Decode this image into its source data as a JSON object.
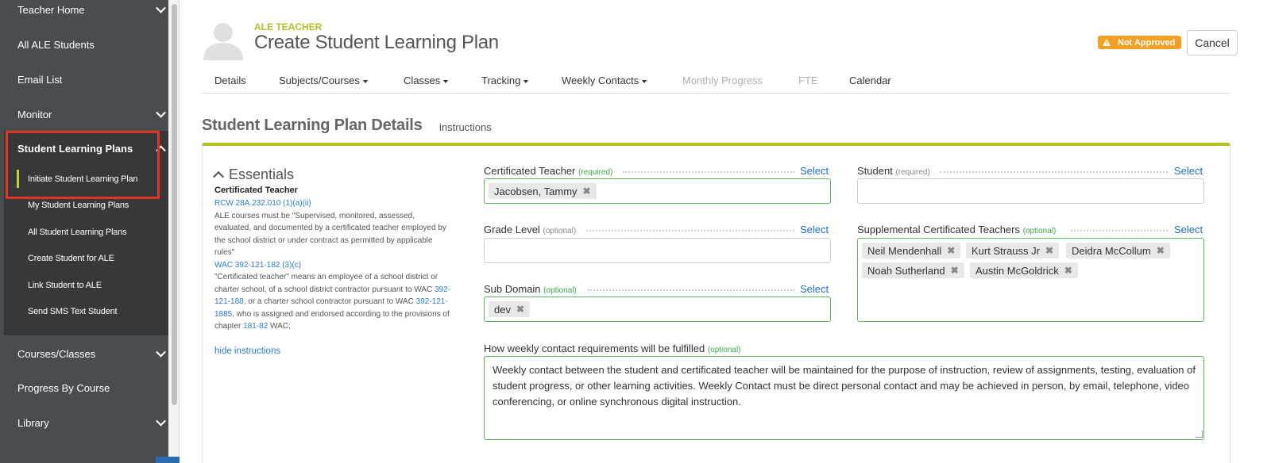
{
  "sidebar": {
    "items": [
      {
        "label": "Teacher Home"
      },
      {
        "label": "All ALE Students"
      },
      {
        "label": "Email List"
      },
      {
        "label": "Monitor"
      },
      {
        "label": "Student Learning Plans"
      },
      {
        "label": "Courses/Classes"
      },
      {
        "label": "Progress By Course"
      },
      {
        "label": "Library"
      }
    ],
    "subitems": [
      {
        "label": "Initiate Student Learning Plan"
      },
      {
        "label": "My Student Learning Plans"
      },
      {
        "label": "All Student Learning Plans"
      },
      {
        "label": "Create Student for ALE"
      },
      {
        "label": "Link Student to ALE"
      },
      {
        "label": "Send SMS Text Student"
      }
    ]
  },
  "header": {
    "role": "ALE TEACHER",
    "title": "Create Student Learning Plan",
    "status_badge": "Not Approved",
    "cancel_label": "Cancel"
  },
  "tabs": [
    {
      "label": "Details"
    },
    {
      "label": "Subjects/Courses"
    },
    {
      "label": "Classes"
    },
    {
      "label": "Tracking"
    },
    {
      "label": "Weekly Contacts"
    },
    {
      "label": "Monthly Progress"
    },
    {
      "label": "FTE"
    },
    {
      "label": "Calendar"
    }
  ],
  "section": {
    "title": "Student Learning Plan Details",
    "instructions_link": "instructions"
  },
  "essentials": {
    "heading": "Essentials",
    "subheading": "Certificated Teacher",
    "ref1": "RCW 28A.232.010 (1)(a)(ii)",
    "text1": "ALE courses must be \"Supervised, monitored, assessed, evaluated, and documented by a certificated teacher employed by the school district or under contract as permitted by applicable rules\"",
    "ref2": "WAC 392-121-182 (3)(c)",
    "text2a": "\"Certificated teacher\" means an employee of a school district or charter school, of a school district contractor pursuant to WAC ",
    "ref3": "392-121-188",
    "text2b": ", or a charter school contractor pursuant to WAC ",
    "ref4": "392-121-1885",
    "text2c": ", who is assigned and endorsed according to the provisions of chapter ",
    "ref5": "181-82",
    "text2d": " WAC;",
    "hide_label": "hide instructions"
  },
  "form": {
    "select_label": "Select",
    "certificated_teacher": {
      "label": "Certificated Teacher",
      "hint": "(required)",
      "value": "Jacobsen, Tammy"
    },
    "student": {
      "label": "Student",
      "hint": "(required)"
    },
    "grade_level": {
      "label": "Grade Level",
      "hint": "(optional)"
    },
    "supplemental": {
      "label": "Supplemental Certificated Teachers",
      "hint": "(optional)",
      "values": [
        "Neil Mendenhall",
        "Kurt Strauss Jr",
        "Deidra McCollum",
        "Noah Sutherland",
        "Austin McGoldrick"
      ]
    },
    "sub_domain": {
      "label": "Sub Domain",
      "hint": "(optional)",
      "value": "dev"
    },
    "weekly_contact": {
      "label": "How weekly contact requirements will be fulfilled",
      "hint": "(optional)",
      "value": "Weekly contact between the student and certificated teacher will be maintained for the purpose of instruction, review of assignments, testing, evaluation of student progress, or other learning activities. Weekly Contact must be direct personal contact and may be achieved in person, by email, telephone, video conferencing, or online synchronous digital instruction."
    }
  },
  "colors": {
    "accent": "#b5c025",
    "badge": "#f4a023",
    "link": "#2a7ad6",
    "highlight": "#e53323",
    "sidebar": "#4a4d50"
  },
  "icons": [
    "chevron-down-icon",
    "chevron-up-icon",
    "avatar-icon",
    "warning-icon",
    "remove-tag-icon"
  ]
}
